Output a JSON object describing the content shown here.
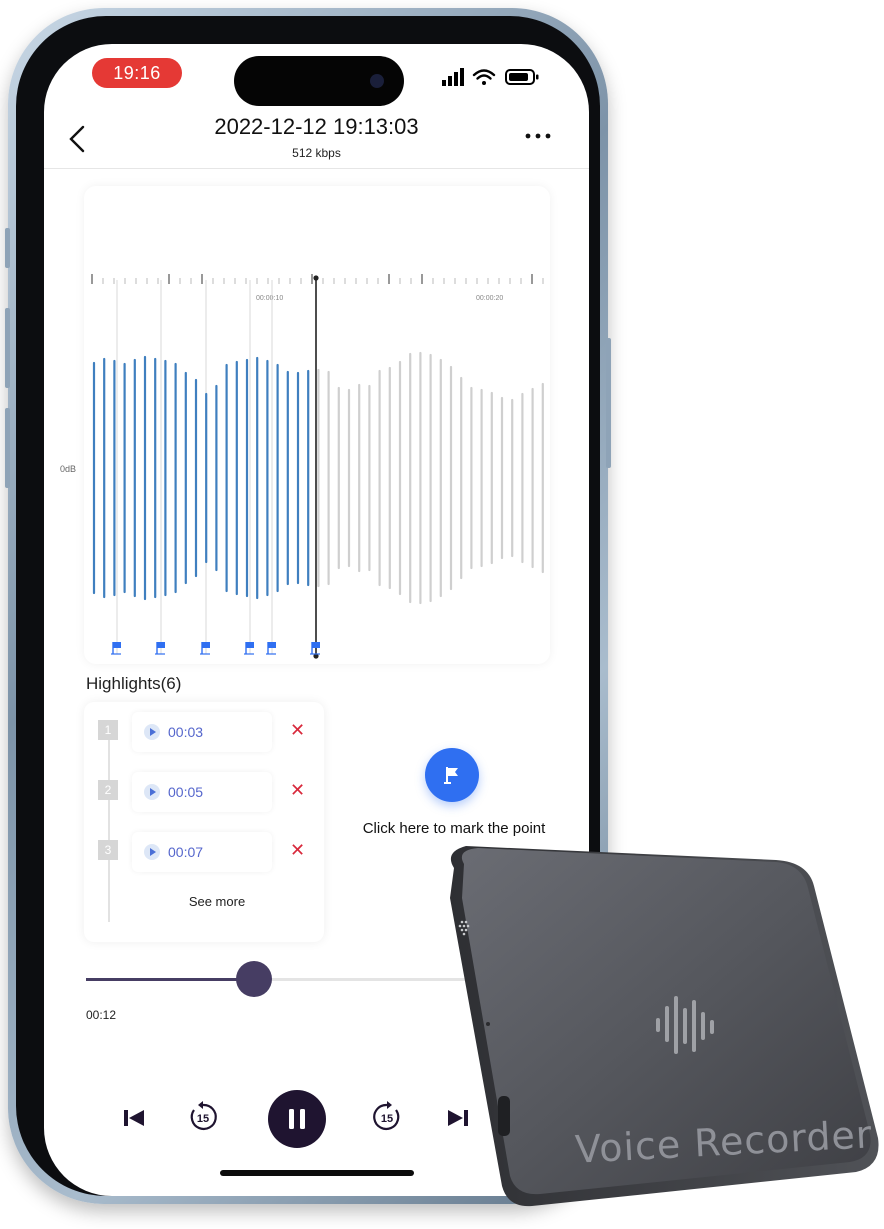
{
  "status_bar": {
    "time": "19:16",
    "icons": [
      "signal-icon",
      "wifi-icon",
      "battery-icon"
    ]
  },
  "header": {
    "title": "2022-12-12 19:13:03",
    "subtitle": "512 kbps",
    "back_icon": "back-arrow-icon",
    "more_icon": "more-icon"
  },
  "waveform": {
    "ruler_labels": [
      "00:00:10",
      "00:00:20"
    ],
    "level_label": "0dB",
    "marker_count": 6,
    "colors": {
      "played": "#3f7fbf",
      "unplayed": "#cfcfcf",
      "flag": "#2f6ff1",
      "playhead": "#222222"
    }
  },
  "highlights": {
    "title": "Highlights(6)",
    "items": [
      {
        "index": "1",
        "time": "00:03"
      },
      {
        "index": "2",
        "time": "00:05"
      },
      {
        "index": "3",
        "time": "00:07"
      }
    ],
    "see_more": "See more",
    "remove_icon": "close-icon"
  },
  "mark": {
    "label": "Click here to mark the point",
    "icon": "flag-icon",
    "color": "#2f6ff1"
  },
  "playback": {
    "elapsed": "00:12",
    "progress": 0.35,
    "skip_back_label": "15",
    "skip_forward_label": "15",
    "accent": "#463d63"
  },
  "device": {
    "label": "Voice Recorder"
  }
}
